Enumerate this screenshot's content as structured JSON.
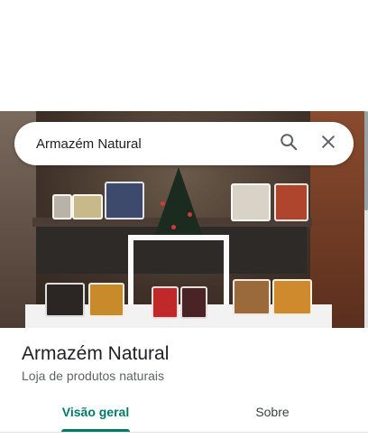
{
  "search": {
    "query": "Armazém Natural",
    "search_icon": "search-icon",
    "close_icon": "close-icon"
  },
  "hero": {
    "description_icon": "store-photo"
  },
  "place": {
    "name": "Armazém Natural",
    "category": "Loja de produtos naturais"
  },
  "tabs": [
    {
      "label": "Visão geral",
      "selected": true
    },
    {
      "label": "Sobre",
      "selected": false
    }
  ],
  "colors": {
    "accent": "#00796b",
    "text_primary": "#202124",
    "text_secondary": "#5f6368"
  }
}
